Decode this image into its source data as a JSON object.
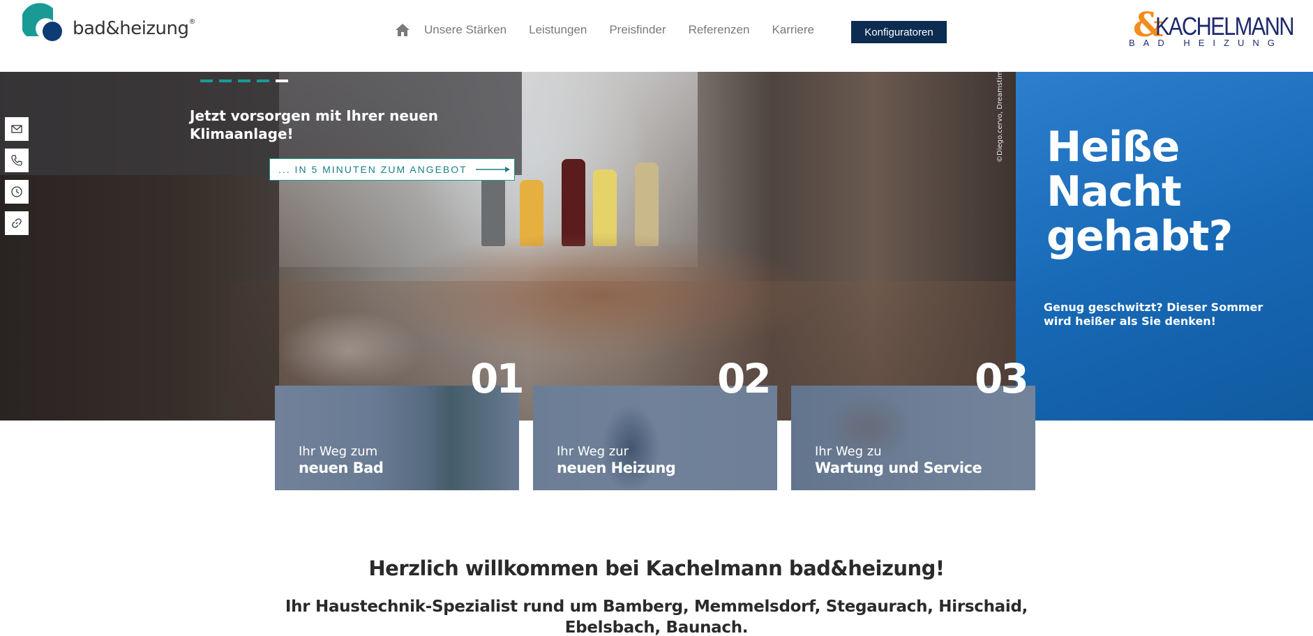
{
  "header": {
    "logo_left": {
      "text": "bad&heizung",
      "registered": "®",
      "colors": {
        "teal": "#1a9a95",
        "navy": "#0d3b74"
      }
    },
    "nav": {
      "home_icon": "home-icon",
      "items": [
        {
          "label": "Unsere Stärken"
        },
        {
          "label": "Leistungen"
        },
        {
          "label": "Preisfinder"
        },
        {
          "label": "Referenzen"
        },
        {
          "label": "Karriere"
        }
      ],
      "cta_label": "Konfiguratoren"
    },
    "logo_right": {
      "amp": "&",
      "brand": "KACHELMANN",
      "sub": "BAD HEIZUNG",
      "colors": {
        "orange": "#f28c1b",
        "navy": "#1d2a6b"
      }
    }
  },
  "hero": {
    "slide_count": 5,
    "active_slide": 5,
    "title": "Jetzt vorsorgen mit Ihrer neuen Klimaanlage!",
    "button_label": "... IN 5 MINUTEN ZUM ANGEBOT",
    "photo_credit": "©Diego.cervo, Dreamstime",
    "promo": {
      "headline": "Heiße Nacht gehabt?",
      "text": "Genug geschwitzt? Dieser Sommer wird heißer als Sie denken!",
      "color": "#1a6bb8"
    }
  },
  "sidebar": {
    "icons": [
      "mail-icon",
      "phone-icon",
      "clock-icon",
      "link-icon"
    ]
  },
  "cards": [
    {
      "number": "01",
      "line1": "Ihr Weg zum",
      "line2": "neuen Bad"
    },
    {
      "number": "02",
      "line1": "Ihr Weg zur",
      "line2": "neuen Heizung"
    },
    {
      "number": "03",
      "line1": "Ihr Weg zu",
      "line2": "Wartung und Service"
    }
  ],
  "welcome": {
    "title": "Herzlich willkommen bei Kachelmann bad&heizung!",
    "subtitle": "Ihr Haustechnik-Spezialist rund um Bamberg, Memmelsdorf, Stegaurach, Hirschaid, Ebelsbach, Baunach."
  }
}
